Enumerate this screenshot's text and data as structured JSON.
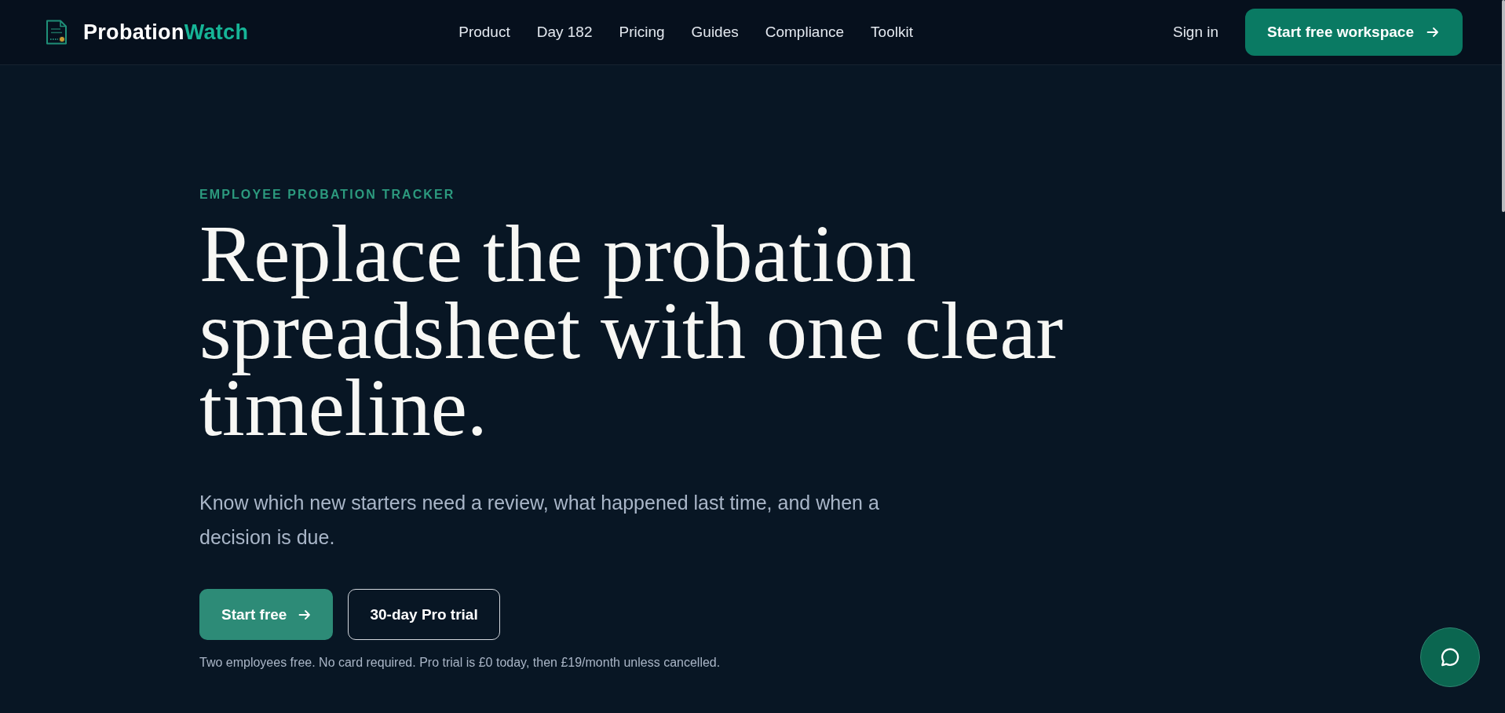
{
  "header": {
    "logo": {
      "text_primary": "Probation",
      "text_accent": "Watch"
    },
    "nav": [
      "Product",
      "Day 182",
      "Pricing",
      "Guides",
      "Compliance",
      "Toolkit"
    ],
    "sign_in": "Sign in",
    "cta": "Start free workspace"
  },
  "hero": {
    "eyebrow": "EMPLOYEE PROBATION TRACKER",
    "heading": "Replace the probation spreadsheet with one clear timeline.",
    "lead": "Know which new starters need a review, what happened last time, and when a decision is due.",
    "buttons": [
      {
        "label": "Start free",
        "kind": "primary"
      },
      {
        "label": "30-day Pro trial",
        "kind": "outline"
      }
    ],
    "note": "Two employees free. No card required. Pro trial is £0 today, then £19/month unless cancelled."
  }
}
